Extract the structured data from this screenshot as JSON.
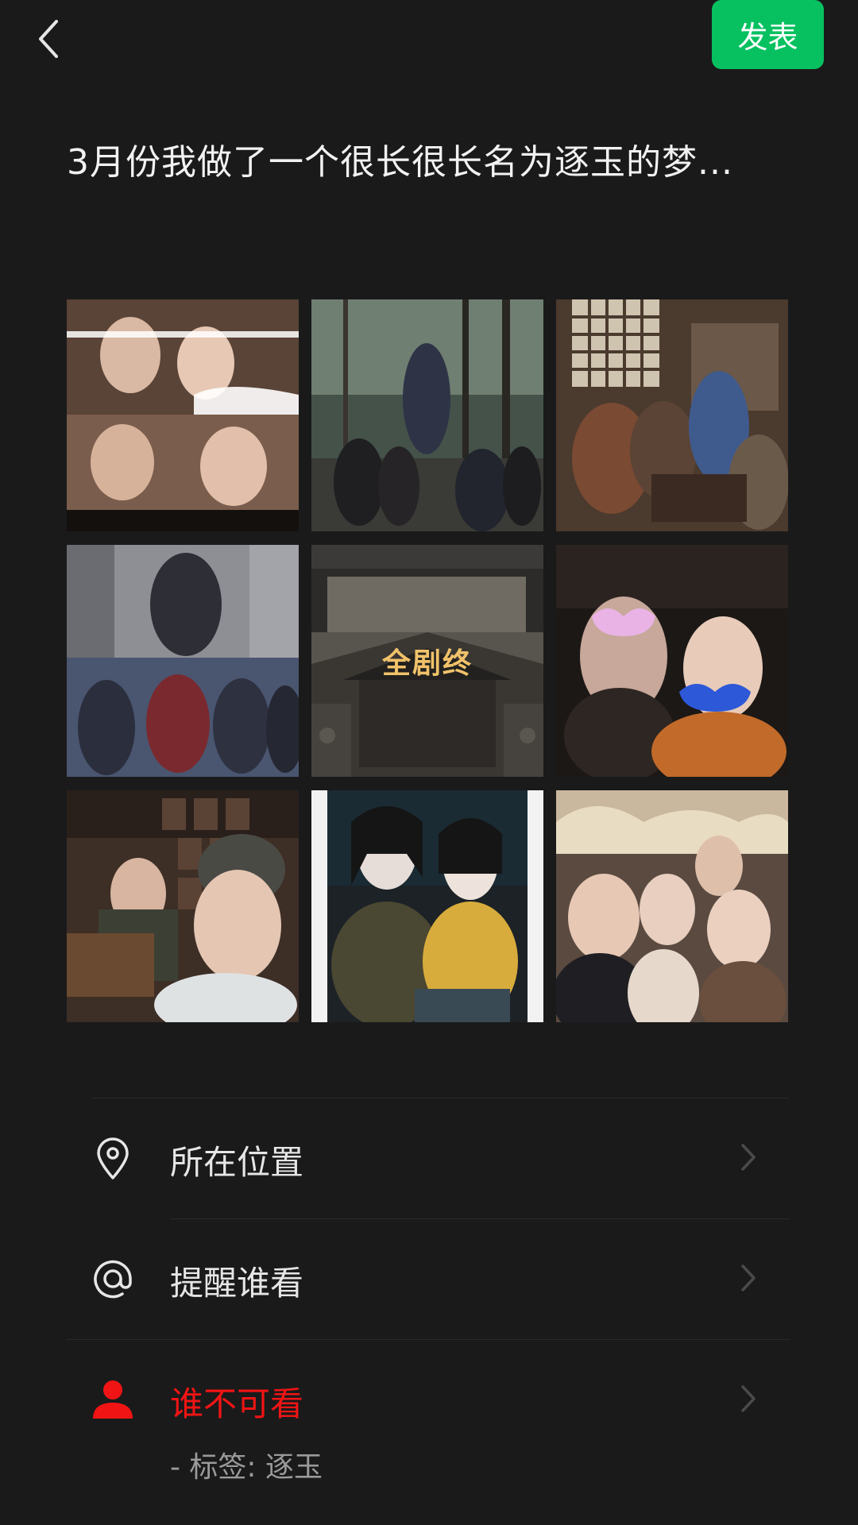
{
  "header": {
    "back_icon": "chevron-left-icon",
    "post_label": "发表",
    "accent": "#07c160"
  },
  "post": {
    "text": "3月份我做了一个很长很长名为逐玉的梦..."
  },
  "photos": [
    {
      "caption": ""
    },
    {
      "caption": ""
    },
    {
      "caption": ""
    },
    {
      "caption": ""
    },
    {
      "caption": "全剧终"
    },
    {
      "caption": ""
    },
    {
      "caption": ""
    },
    {
      "caption": ""
    },
    {
      "caption": ""
    }
  ],
  "options": {
    "location": {
      "label": "所在位置",
      "icon": "location-pin-icon"
    },
    "mention": {
      "label": "提醒谁看",
      "icon": "at-icon"
    },
    "visibility": {
      "label": "谁不可看",
      "icon": "person-icon",
      "sub": "- 标签: 逐玉",
      "color": "#f01414"
    }
  }
}
